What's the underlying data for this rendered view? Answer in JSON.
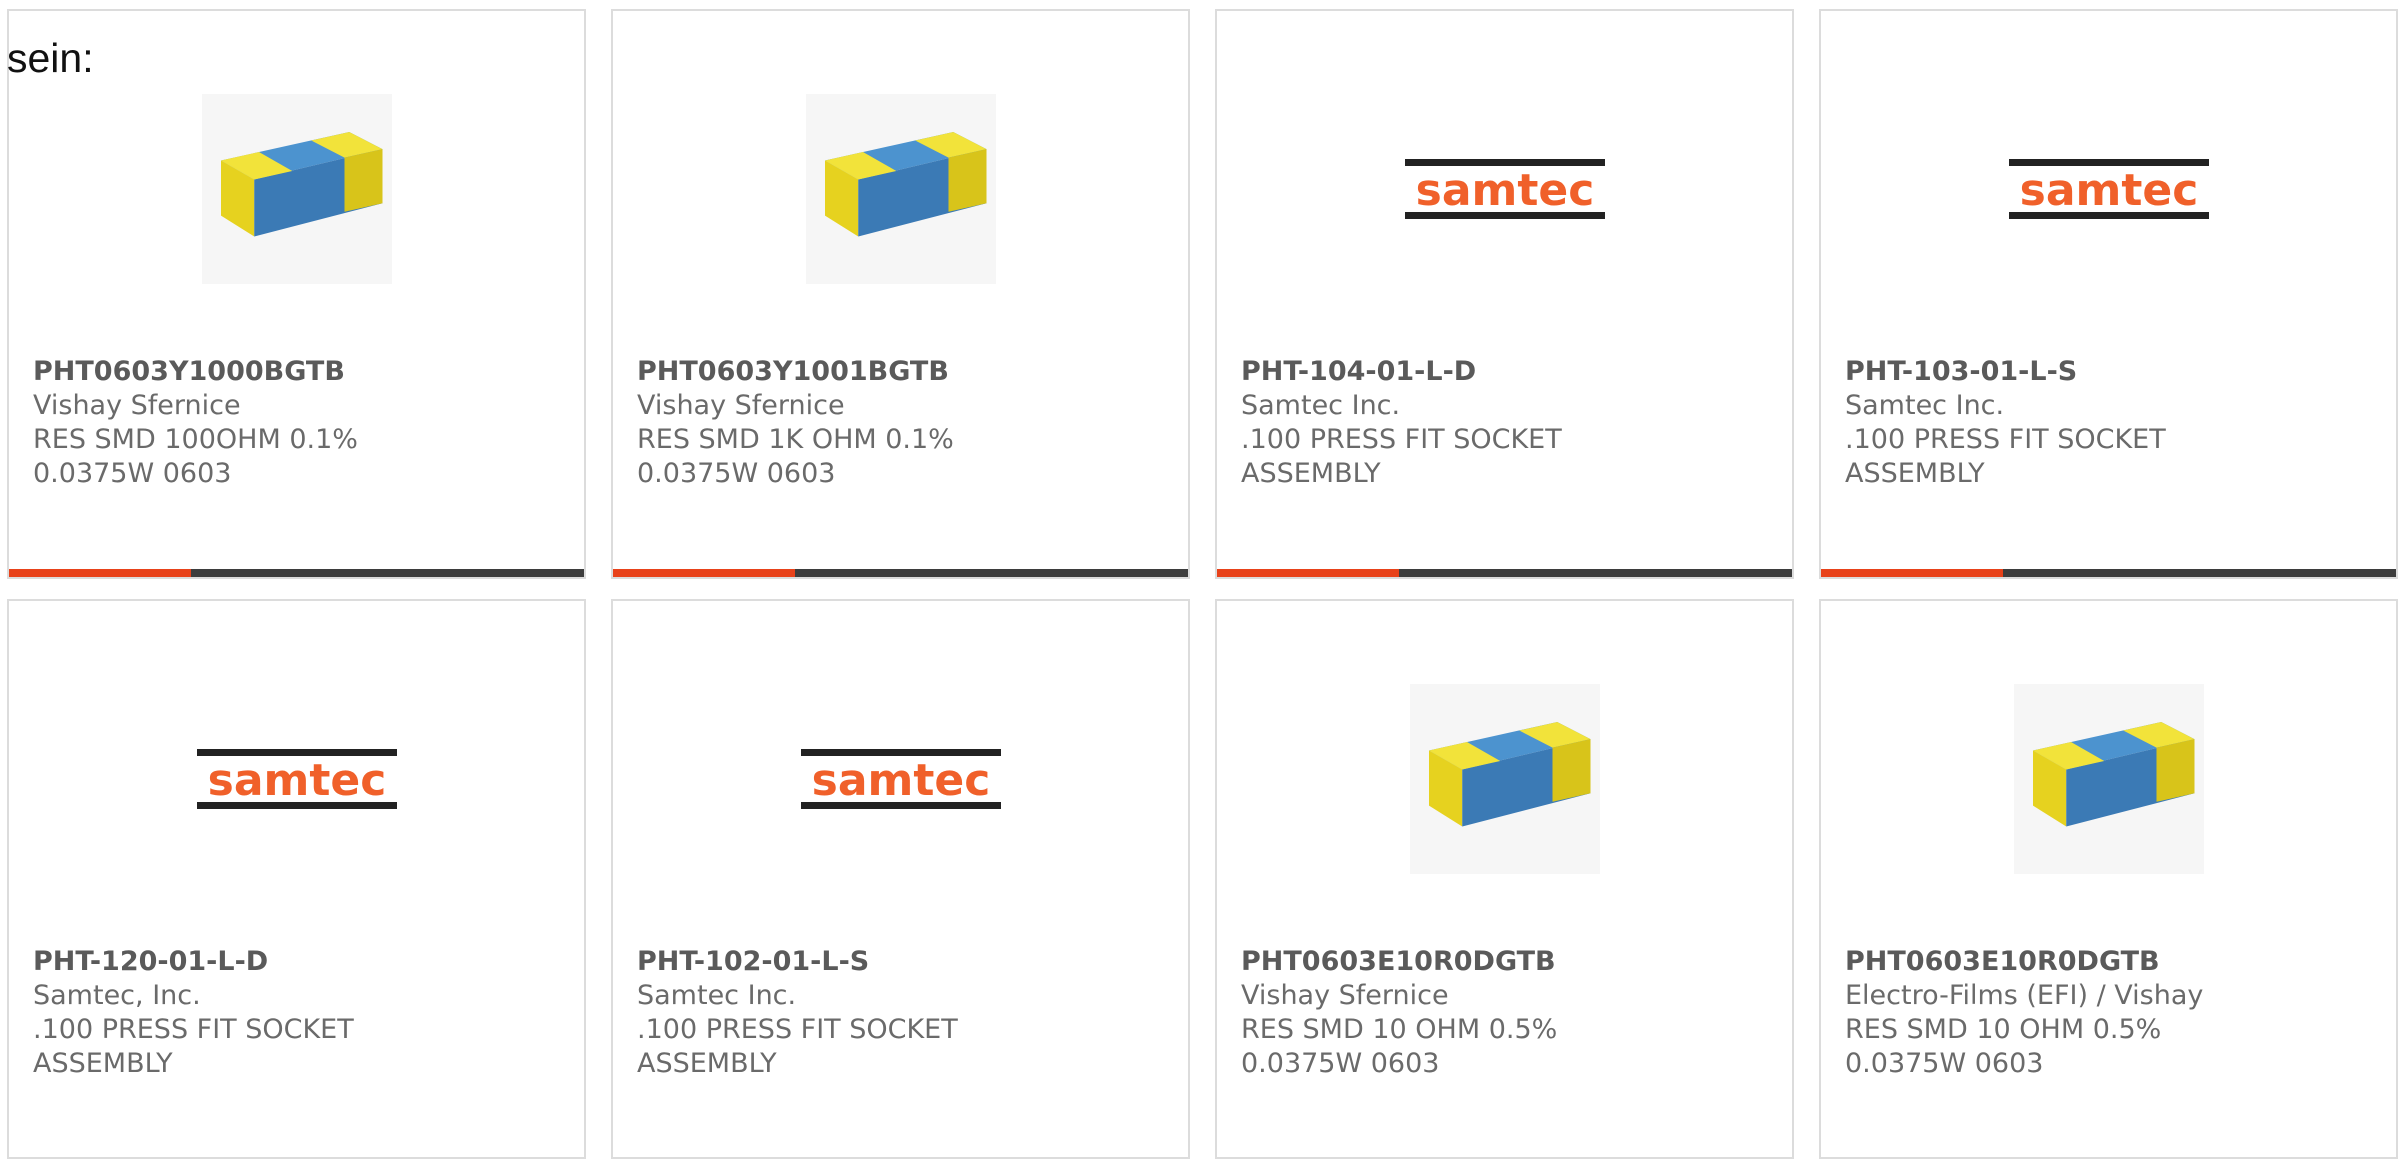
{
  "intro": "sein:",
  "colors": {
    "accent": "#e8421a",
    "bar": "#3d3d3d",
    "chip_body": "#3b7ab5",
    "chip_cap": "#e6d21f",
    "samtec_orange": "#f0602a"
  },
  "cards": [
    {
      "part": "PHT0603Y1000BGTB",
      "manufacturer": "Vishay Sfernice",
      "description": "RES SMD 100OHM 0.1% 0.0375W 0603",
      "image": "resistor-chip-icon"
    },
    {
      "part": "PHT0603Y1001BGTB",
      "manufacturer": "Vishay Sfernice",
      "description": "RES SMD 1K OHM 0.1% 0.0375W 0603",
      "image": "resistor-chip-icon"
    },
    {
      "part": "PHT-104-01-L-D",
      "manufacturer": "Samtec Inc.",
      "description": ".100 PRESS FIT SOCKET ASSEMBLY",
      "image": "samtec-logo",
      "logo_text": "samtec"
    },
    {
      "part": "PHT-103-01-L-S",
      "manufacturer": "Samtec Inc.",
      "description": ".100 PRESS FIT SOCKET ASSEMBLY",
      "image": "samtec-logo",
      "logo_text": "samtec"
    },
    {
      "part": "PHT-120-01-L-D",
      "manufacturer": "Samtec, Inc.",
      "description": ".100 PRESS FIT SOCKET ASSEMBLY",
      "image": "samtec-logo",
      "logo_text": "samtec"
    },
    {
      "part": "PHT-102-01-L-S",
      "manufacturer": "Samtec Inc.",
      "description": ".100 PRESS FIT SOCKET ASSEMBLY",
      "image": "samtec-logo",
      "logo_text": "samtec"
    },
    {
      "part": "PHT0603E10R0DGTB",
      "manufacturer": "Vishay Sfernice",
      "description": "RES SMD 10 OHM 0.5% 0.0375W 0603",
      "image": "resistor-chip-icon"
    },
    {
      "part": "PHT0603E10R0DGTB",
      "manufacturer": "Electro-Films (EFI) / Vishay",
      "description": "RES SMD 10 OHM 0.5% 0.0375W 0603",
      "image": "resistor-chip-icon"
    }
  ]
}
